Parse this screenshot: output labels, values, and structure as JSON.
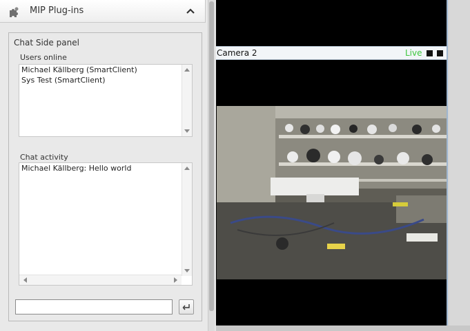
{
  "plugins": {
    "title": "MIP Plug-ins",
    "icon": "puzzle-icon",
    "collapse_icon": "chevron-up-icon"
  },
  "chat_panel": {
    "title": "Chat Side panel",
    "users_label": "Users online",
    "users": [
      "Michael Källberg (SmartClient)",
      "Sys Test (SmartClient)"
    ],
    "activity_label": "Chat activity",
    "messages": [
      "Michael Källberg: Hello world"
    ],
    "input_value": "",
    "send_icon": "enter-icon"
  },
  "camera": {
    "name": "Camera 2",
    "status": "Live",
    "live_color": "#3cc63c"
  }
}
